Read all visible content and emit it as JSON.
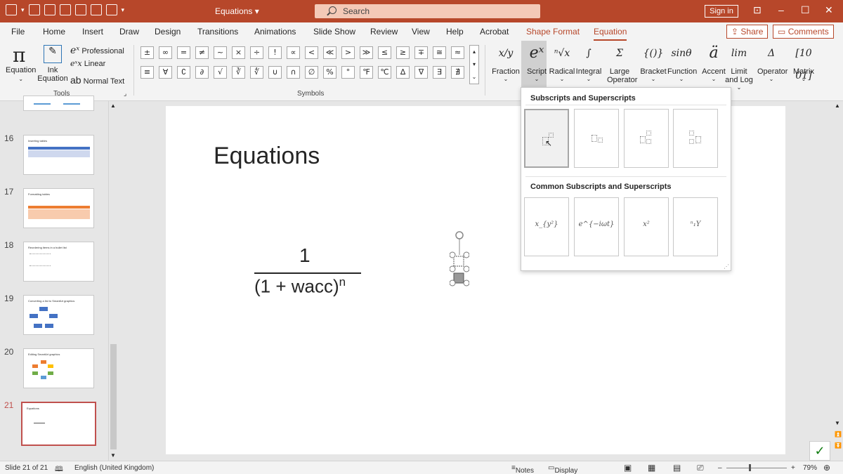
{
  "window": {
    "doc_title": "Equations",
    "search_placeholder": "Search",
    "signin_label": "Sign in"
  },
  "tabs": [
    "File",
    "Home",
    "Insert",
    "Draw",
    "Design",
    "Transitions",
    "Animations",
    "Slide Show",
    "Review",
    "View",
    "Help",
    "Acrobat",
    "Shape Format",
    "Equation"
  ],
  "share_label": "Share",
  "comments_label": "Comments",
  "ribbon": {
    "tools": {
      "equation_label": "Equation",
      "ink_equation_label": "Ink Equation",
      "professional_label": "Professional",
      "linear_label": "Linear",
      "normal_text_label": "Normal Text",
      "group_label": "Tools"
    },
    "symbols": {
      "row1": [
        "±",
        "∞",
        "=",
        "≠",
        "~",
        "×",
        "÷",
        "!",
        "∝",
        "<",
        "≪",
        ">",
        "≫",
        "≤",
        "≥",
        "∓",
        "≅",
        "≈"
      ],
      "row2": [
        "≡",
        "∀",
        "∁",
        "∂",
        "√",
        "∛",
        "∜",
        "∪",
        "∩",
        "∅",
        "%",
        "°",
        "℉",
        "℃",
        "∆",
        "∇",
        "∃",
        "∄"
      ],
      "group_label": "Symbols"
    },
    "structures": [
      {
        "label": "Fraction",
        "glyph": "x/y"
      },
      {
        "label": "Script",
        "glyph": "eˣ"
      },
      {
        "label": "Radical",
        "glyph": "ⁿ√x"
      },
      {
        "label": "Integral",
        "glyph": "∫"
      },
      {
        "label": "Large Operator",
        "glyph": "Σ"
      },
      {
        "label": "Bracket",
        "glyph": "{()}"
      },
      {
        "label": "Function",
        "glyph": "sinθ"
      },
      {
        "label": "Accent",
        "glyph": "ä"
      },
      {
        "label": "Limit and Log",
        "glyph": "lim"
      },
      {
        "label": "Operator",
        "glyph": "Δ"
      },
      {
        "label": "Matrix",
        "glyph": "[10 01]"
      }
    ]
  },
  "slides": [
    {
      "num": "16",
      "title": "Inserting tables"
    },
    {
      "num": "17",
      "title": "Formatting tables"
    },
    {
      "num": "18",
      "title": "Reordering items in a bullet list"
    },
    {
      "num": "19",
      "title": "Converting a list to SmartArt graphics"
    },
    {
      "num": "20",
      "title": "Editing SmartArt graphics"
    },
    {
      "num": "21",
      "title": "Equations"
    }
  ],
  "slide": {
    "title": "Equations",
    "numerator": "1",
    "denominator": "(1 + wacc)",
    "exponent": "n"
  },
  "gallery": {
    "heading1": "Subscripts and Superscripts",
    "heading2": "Common Subscripts and Superscripts",
    "common": [
      "x_{y²}",
      "e^{−iωt}",
      "x²",
      "ⁿ₁Y"
    ]
  },
  "status": {
    "slide_count": "Slide 21 of 21",
    "language": "English (United Kingdom)",
    "notes": "Notes",
    "display_settings": "Display Settings",
    "zoom": "79%"
  }
}
